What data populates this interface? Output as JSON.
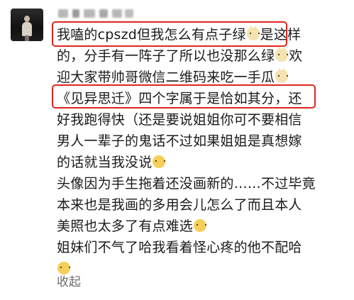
{
  "post": {
    "lines": [
      {
        "text": "我嗑的cpszd但我怎么有点子绿",
        "emoji_after": "cat-icon",
        "tail": "是这样"
      },
      {
        "text": "的，分手有一阵子了所以也没那么绿",
        "emoji_after": "cat-icon",
        "tail": "欢"
      },
      {
        "text": "迎大家带帅哥微信二维码来吃一手瓜",
        "emoji_after": "cat-icon",
        "tail": ""
      },
      {
        "text": "《见异思迁》四个字属于是恰如其分，还",
        "emoji_after": "",
        "tail": ""
      },
      {
        "text": "好我跑得快（还是要说姐姐你可不要相信",
        "emoji_after": "",
        "tail": ""
      },
      {
        "text": "男人一辈子的鬼话不过如果姐姐是真想嫁",
        "emoji_after": "",
        "tail": ""
      },
      {
        "text": "的话就当我没说",
        "emoji_after": "sweat-emoji",
        "tail": ""
      },
      {
        "text": "头像因为手生拖着还没画新的……不过毕竟",
        "emoji_after": "",
        "tail": ""
      },
      {
        "text": "本来也是我画的多用会儿怎么了而且本人",
        "emoji_after": "",
        "tail": ""
      },
      {
        "text": "美照也太多了有点难选",
        "emoji_after": "shy-emoji",
        "tail": ""
      },
      {
        "text": "姐妹们不气了哈我看着怪心疼的他不配哈",
        "emoji_after": "",
        "tail": ""
      },
      {
        "text": "",
        "emoji_after": "pleading-emoji",
        "tail": ""
      }
    ]
  },
  "actions": {
    "collapse_label": "收起"
  },
  "colors": {
    "highlight": "#e0251d",
    "text": "#1a1a1a",
    "muted": "#6f6f6f"
  }
}
